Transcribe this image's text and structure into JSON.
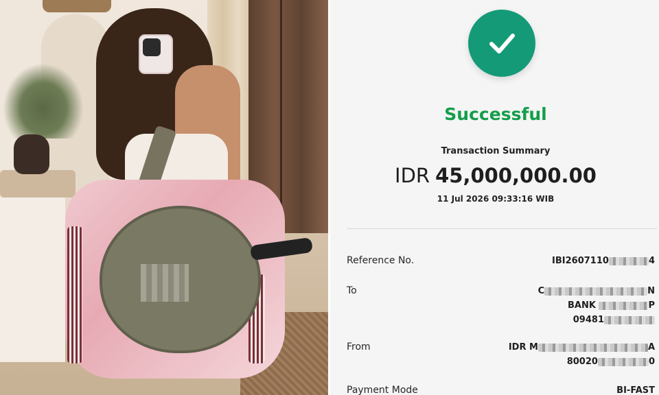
{
  "receipt": {
    "status": "Successful",
    "summary_title": "Transaction Summary",
    "currency": "IDR",
    "amount": "45,000,000.00",
    "datetime": "11 Jul 2026 09:33:16 WIB",
    "rows": [
      {
        "label": "Reference No.",
        "lines": [
          {
            "prefix": "IBI2607110",
            "suffix": "4"
          }
        ]
      },
      {
        "label": "To",
        "lines": [
          {
            "prefix": "C",
            "suffix": "N"
          },
          {
            "prefix": "BANK",
            "suffix": "P"
          },
          {
            "prefix": "09481",
            "suffix": ""
          }
        ]
      },
      {
        "label": "From",
        "lines": [
          {
            "prefix": "IDR M",
            "suffix": "A"
          },
          {
            "prefix": "80020",
            "suffix": "0"
          }
        ]
      },
      {
        "label": "Payment Mode",
        "lines": [
          {
            "prefix": "BI-FAST",
            "suffix": ""
          }
        ]
      }
    ]
  },
  "colors": {
    "success_green": "#149e4a",
    "check_circle": "#159a78",
    "receipt_bg": "#f5f5f5"
  },
  "icons": {
    "status_icon": "checkmark-circle-icon"
  }
}
